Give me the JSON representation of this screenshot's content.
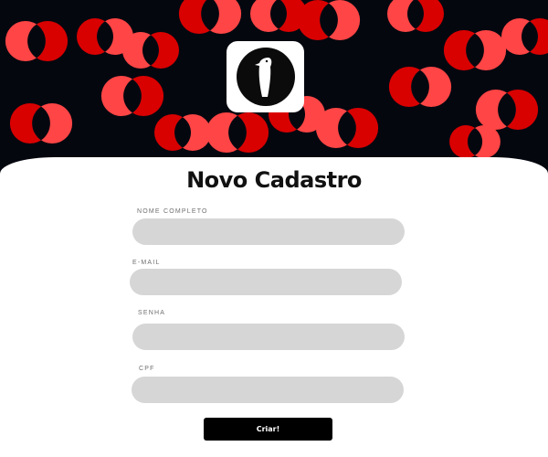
{
  "form": {
    "title": "Novo Cadastro",
    "fields": [
      {
        "label": "NOME COMPLETO",
        "value": "",
        "placeholder": ""
      },
      {
        "label": "E-MAIL",
        "value": "",
        "placeholder": ""
      },
      {
        "label": "SENHA",
        "value": "",
        "placeholder": ""
      },
      {
        "label": "CPF",
        "value": "",
        "placeholder": ""
      }
    ],
    "submit_label": "Criar!"
  },
  "colors": {
    "hero_background": "#05070f",
    "circle_dark_red": "#d90000",
    "circle_light_red": "#ff4545",
    "field_background": "#d6d6d6",
    "button_background": "#000000"
  },
  "logo": {
    "icon": "woodpecker-bird-icon"
  }
}
